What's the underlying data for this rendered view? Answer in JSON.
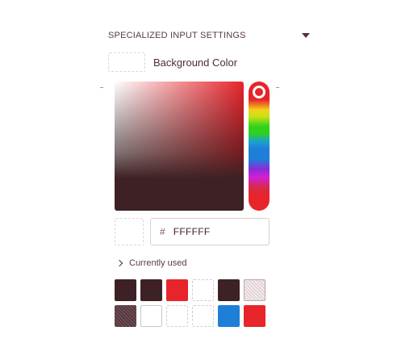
{
  "section": {
    "title": "SPECIALIZED INPUT SETTINGS"
  },
  "background_color": {
    "label": "Background Color",
    "current": "#FFFFFF"
  },
  "picker": {
    "base_hue_color": "#E8242B",
    "shade_color": "#3E2124",
    "hex_prefix": "#",
    "hex_value": "FFFFFF"
  },
  "recent": {
    "label": "Currently used",
    "swatches": [
      {
        "color": "#3E2124",
        "style": "solid"
      },
      {
        "color": "#3E2124",
        "style": "solid"
      },
      {
        "color": "#E8242B",
        "style": "solid"
      },
      {
        "color": "#FFFFFF",
        "style": "empty"
      },
      {
        "color": "#3E2124",
        "style": "solid"
      },
      {
        "color": "#E8D9DA",
        "style": "pattern"
      },
      {
        "color": "#4A2E35",
        "style": "pattern-dark"
      },
      {
        "color": "#FFFFFF",
        "style": "white-solid"
      },
      {
        "color": "#FFFFFF",
        "style": "empty"
      },
      {
        "color": "#FFFFFF",
        "style": "empty"
      },
      {
        "color": "#1E7FD9",
        "style": "solid"
      },
      {
        "color": "#E8242B",
        "style": "solid"
      }
    ]
  }
}
